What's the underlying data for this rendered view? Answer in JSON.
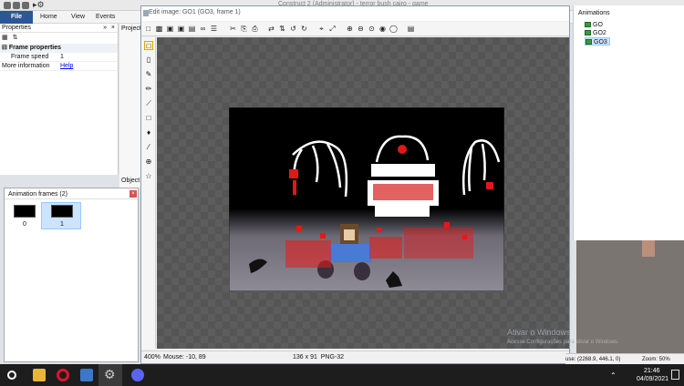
{
  "app": {
    "title": "Construct 2 (Administrator) - terror bush cairo - game"
  },
  "ribbon": {
    "tabs": [
      "File",
      "Home",
      "View",
      "Events"
    ]
  },
  "properties_panel": {
    "title": "Properties",
    "pin": "»",
    "close": "×",
    "section": "Frame properties",
    "rows": [
      {
        "label": "Frame speed",
        "value": "1"
      },
      {
        "label": "More information",
        "value": "Help"
      }
    ]
  },
  "side_strip": {
    "projects_label": "Projects",
    "objects_label": "Object"
  },
  "animation_frames": {
    "title": "Animation frames (2)",
    "frames": [
      {
        "index": "0",
        "selected": false
      },
      {
        "index": "1",
        "selected": true
      }
    ]
  },
  "editor": {
    "title": "Edit image: GO1 (GO3, frame 1)",
    "status": {
      "zoom": "400%",
      "mouse": "Mouse: -10, 89",
      "size_format": "136 x 91  PNG-32"
    }
  },
  "animations_panel": {
    "title": "Animations",
    "items": [
      "GO",
      "GO2",
      "GO3"
    ],
    "selected": "GO3"
  },
  "status_right": {
    "mouse": "use: (2268.9, 446.1, 0)",
    "zoom": "Zoom: 50%"
  },
  "watermark": {
    "line1": "Ativar o Windows",
    "line2": "Acesse Configurações para ativar o Windows."
  },
  "taskbar": {
    "time": "21:46",
    "date": "04/09/2021"
  },
  "colors": {
    "file_tab": "#2b5797",
    "link": "#0000ee",
    "selected_frame": "#cce4ff",
    "blood_red": "#dd1111"
  }
}
